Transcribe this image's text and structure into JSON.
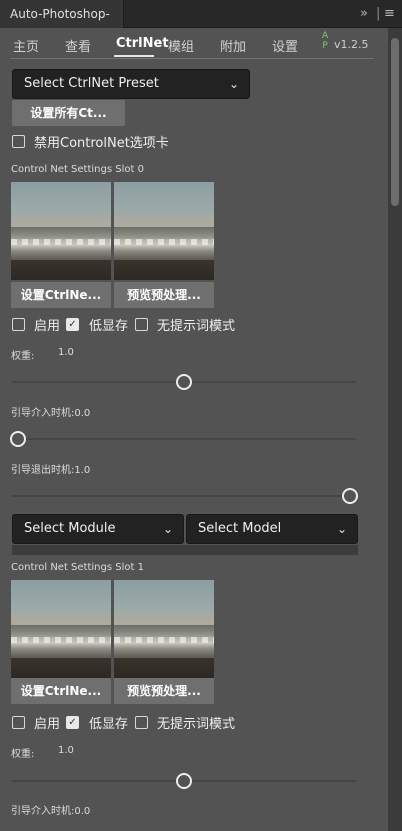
{
  "window": {
    "title": "Auto-Photoshop-SD"
  },
  "tabs": [
    {
      "label": "主页"
    },
    {
      "label": "查看"
    },
    {
      "label": "CtrlNet",
      "active": true
    },
    {
      "label": "模组"
    },
    {
      "label": "附加"
    },
    {
      "label": "设置"
    }
  ],
  "brand": {
    "a": "A",
    "p": "P",
    "version": "v1.2.5"
  },
  "preset": {
    "label": "Select CtrlNet Preset",
    "set_all_button": "设置所有Ct..."
  },
  "disable_tab": {
    "label": "禁用ControlNet选项卡",
    "checked": false
  },
  "slots": [
    {
      "heading": "Control Net Settings Slot 0",
      "set_button": "设置CtrlNe...",
      "preview_button": "预览预处理...",
      "enable": {
        "label": "启用",
        "checked": false
      },
      "lowvram": {
        "label": "低显存",
        "checked": true
      },
      "guessmode": {
        "label": "无提示词模式",
        "checked": false
      },
      "weight_label": "权重:",
      "weight_value": "1.0",
      "weight_fraction": 0.5,
      "guidance_start_label": "引导介入时机:0.0",
      "guidance_start": 0.0,
      "guidance_end_label": "引导退出时机:1.0",
      "guidance_end": 1.0,
      "module_select": "Select Module",
      "model_select": "Select Model"
    },
    {
      "heading": "Control Net Settings Slot 1",
      "set_button": "设置CtrlNe...",
      "preview_button": "预览预处理...",
      "enable": {
        "label": "启用",
        "checked": false
      },
      "lowvram": {
        "label": "低显存",
        "checked": true
      },
      "guessmode": {
        "label": "无提示词模式",
        "checked": false
      },
      "weight_label": "权重:",
      "weight_value": "1.0",
      "weight_fraction": 0.5,
      "guidance_start_label": "引导介入时机:0.0"
    }
  ],
  "icons": {
    "collapse": "double-chevron-right-icon",
    "menu": "menu-icon",
    "dropdown": "chevron-down-icon",
    "check": "checkmark-icon"
  },
  "colors": {
    "panel_bg": "#535353",
    "titlebar_bg": "#282828",
    "select_bg": "#222222",
    "button_bg": "#6f6f6f"
  }
}
